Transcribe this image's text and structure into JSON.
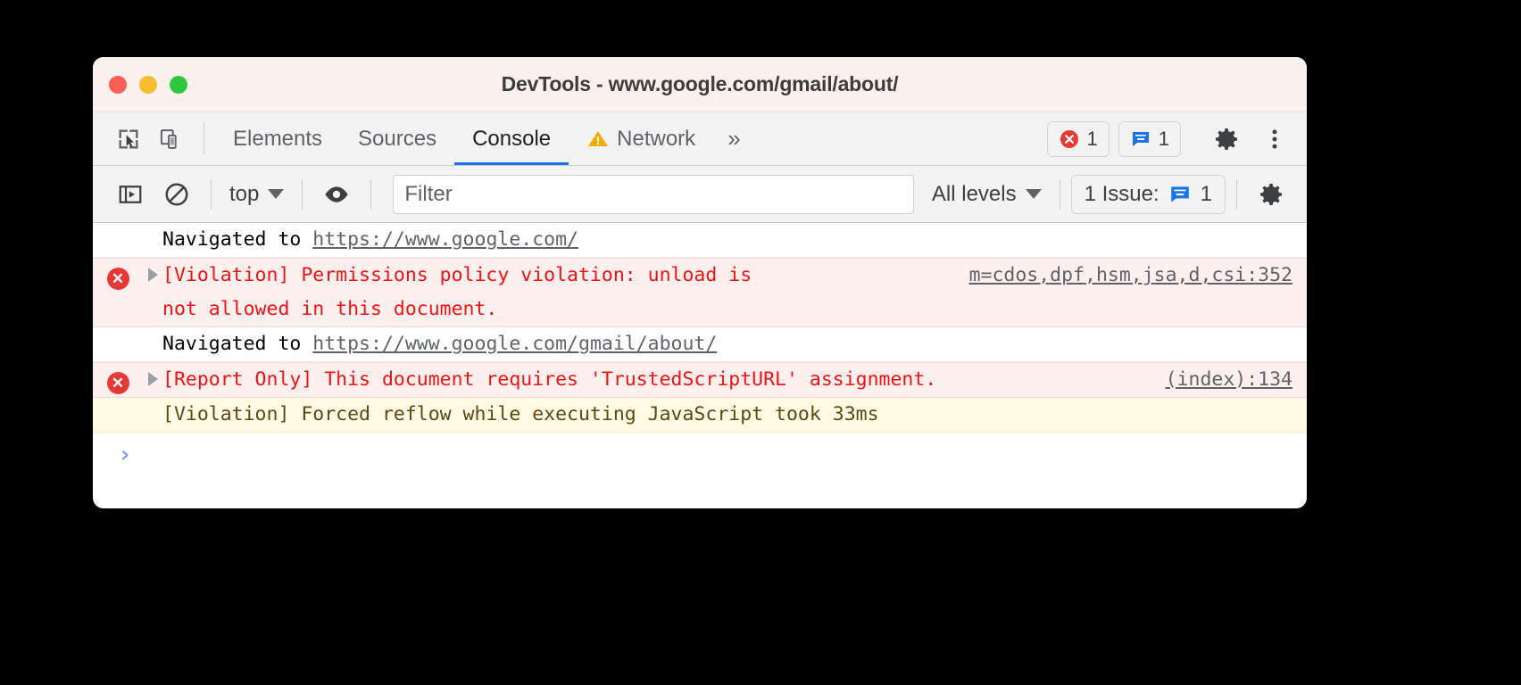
{
  "window": {
    "title": "DevTools - www.google.com/gmail/about/",
    "traffic_lights": [
      {
        "name": "close",
        "color": "#fc5f57"
      },
      {
        "name": "minimize",
        "color": "#f7bd2e"
      },
      {
        "name": "zoom",
        "color": "#2cc93f"
      }
    ]
  },
  "tabbar": {
    "inspect_icon": "inspect-element-icon",
    "device_icon": "device-toolbar-icon",
    "tabs": [
      {
        "label": "Elements",
        "selected": false,
        "warning": false
      },
      {
        "label": "Sources",
        "selected": false,
        "warning": false
      },
      {
        "label": "Console",
        "selected": true,
        "warning": false
      },
      {
        "label": "Network",
        "selected": false,
        "warning": true
      }
    ],
    "more_tabs": "»",
    "error_count": "1",
    "issue_count": "1",
    "settings_icon": "gear-icon",
    "menu_icon": "kebab-menu-icon"
  },
  "console_toolbar": {
    "sidebar_toggle_icon": "console-sidebar-icon",
    "clear_icon": "clear-console-icon",
    "context_selector": "top",
    "eye_icon": "live-expression-icon",
    "filter": {
      "value": "",
      "placeholder": "Filter"
    },
    "levels_selector": "All levels",
    "issues_label": "1 Issue:",
    "issues_count": "1",
    "settings_icon": "console-settings-gear-icon"
  },
  "console_messages": [
    {
      "kind": "info",
      "badge": null,
      "disclosure": false,
      "prefix": "Navigated to ",
      "link_inline": "https://www.google.com/",
      "text": "",
      "source": ""
    },
    {
      "kind": "error",
      "badge": "error-badge",
      "disclosure": true,
      "prefix": "",
      "link_inline": "",
      "text": "[Violation] Permissions policy violation: unload is\nnot allowed in this document.",
      "source": "m=cdos,dpf,hsm,jsa,d,csi:352"
    },
    {
      "kind": "info",
      "badge": null,
      "disclosure": false,
      "prefix": "Navigated to ",
      "link_inline": "https://www.google.com/gmail/about/",
      "text": "",
      "source": ""
    },
    {
      "kind": "error",
      "badge": "error-badge",
      "disclosure": true,
      "prefix": "",
      "link_inline": "",
      "text": "[Report Only] This document requires 'TrustedScriptURL' assignment.",
      "source": "(index):134"
    },
    {
      "kind": "warning",
      "badge": null,
      "disclosure": false,
      "prefix": "",
      "link_inline": "",
      "text": "[Violation] Forced reflow while executing JavaScript took 33ms",
      "source": ""
    }
  ],
  "prompt": {
    "caret": "›"
  },
  "colors": {
    "accent": "#1a73e8",
    "error_text": "#f01313",
    "error_bg": "#fff0f0",
    "warning_bg": "#fffbe5",
    "warning_text": "#5c4813",
    "link": "#1a0dab",
    "titlebar_bg": "#fdf1ef",
    "toolbar_bg": "#f3f3f3"
  }
}
